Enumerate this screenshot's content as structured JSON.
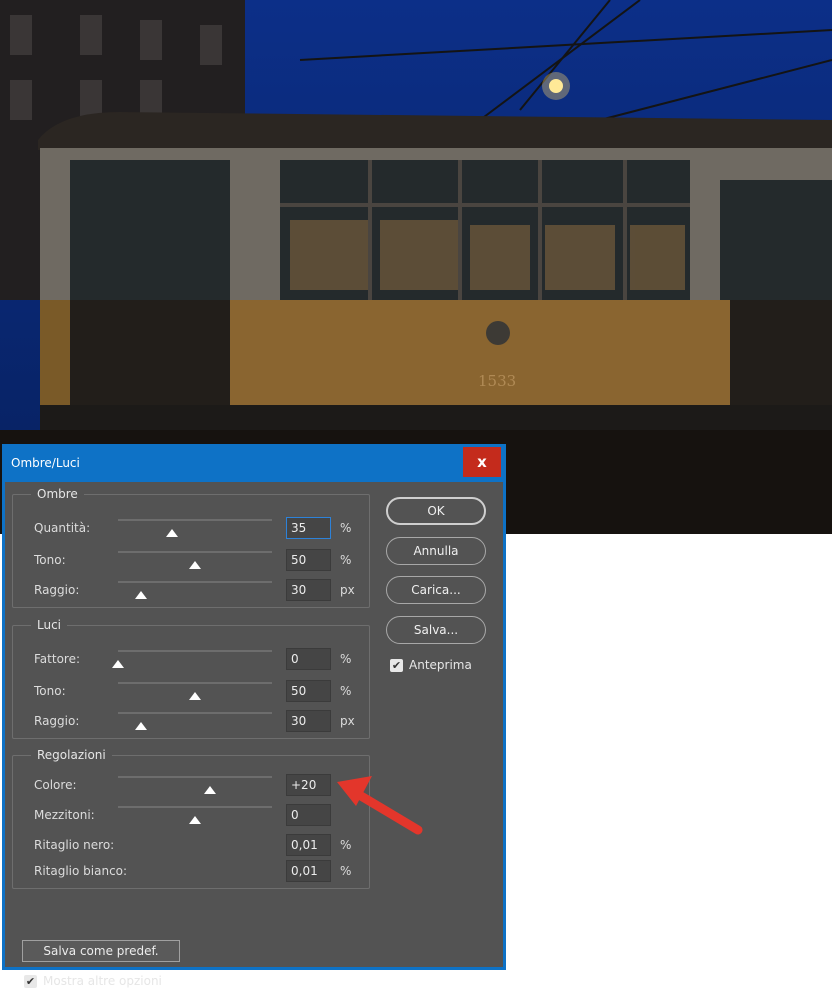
{
  "dialog": {
    "title": "Ombre/Luci",
    "close_glyph": "x"
  },
  "shadows": {
    "title": "Ombre",
    "amount": {
      "label": "Quantità:",
      "value": "35",
      "unit": "%",
      "slider": 0.35
    },
    "tone": {
      "label": "Tono:",
      "value": "50",
      "unit": "%",
      "slider": 0.5
    },
    "radius": {
      "label": "Raggio:",
      "value": "30",
      "unit": "px",
      "slider": 0.15
    }
  },
  "highlights": {
    "title": "Luci",
    "amount": {
      "label": "Fattore:",
      "value": "0",
      "unit": "%",
      "slider": 0.0
    },
    "tone": {
      "label": "Tono:",
      "value": "50",
      "unit": "%",
      "slider": 0.5
    },
    "radius": {
      "label": "Raggio:",
      "value": "30",
      "unit": "px",
      "slider": 0.15
    }
  },
  "adjustments": {
    "title": "Regolazioni",
    "color": {
      "label": "Colore:",
      "value": "+20",
      "slider": 0.6
    },
    "midtones": {
      "label": "Mezzitoni:",
      "value": "0",
      "slider": 0.5
    },
    "black_clip": {
      "label": "Ritaglio nero:",
      "value": "0,01",
      "unit": "%"
    },
    "white_clip": {
      "label": "Ritaglio bianco:",
      "value": "0,01",
      "unit": "%"
    }
  },
  "buttons": {
    "ok": "OK",
    "cancel": "Annulla",
    "load": "Carica...",
    "save": "Salva..."
  },
  "preview": {
    "label": "Anteprima",
    "checked": true
  },
  "save_default_label": "Salva come predef.",
  "more_options": {
    "label": "Mostra altre opzioni",
    "checked": true
  },
  "photo": {
    "tram_number": "1533",
    "annotation_arrow_color": "#e3362b"
  }
}
